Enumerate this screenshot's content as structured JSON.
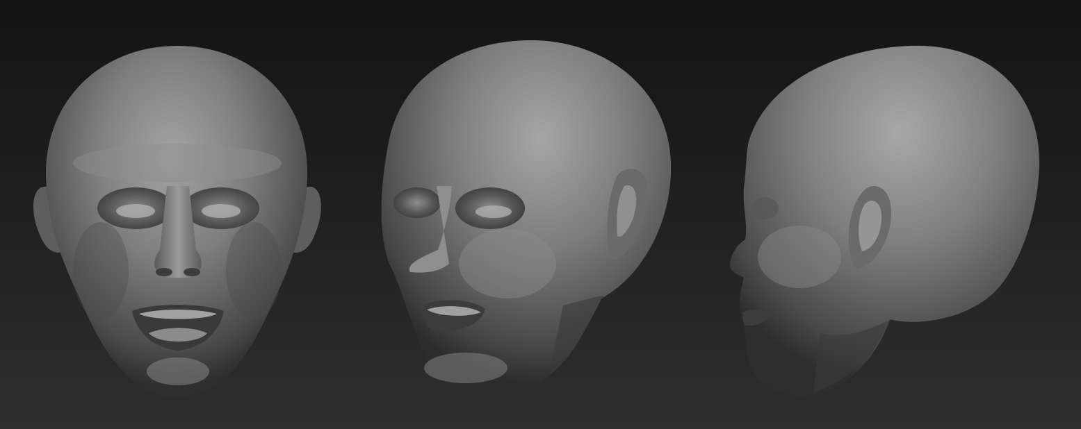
{
  "scene": {
    "background_top": "#141414",
    "background_bottom": "#2e2e2e",
    "material_color": "#7a7a7a",
    "views": [
      {
        "name": "front-view",
        "angle": "front"
      },
      {
        "name": "three-quarter-view",
        "angle": "three-quarter"
      },
      {
        "name": "profile-view",
        "angle": "side"
      }
    ]
  }
}
